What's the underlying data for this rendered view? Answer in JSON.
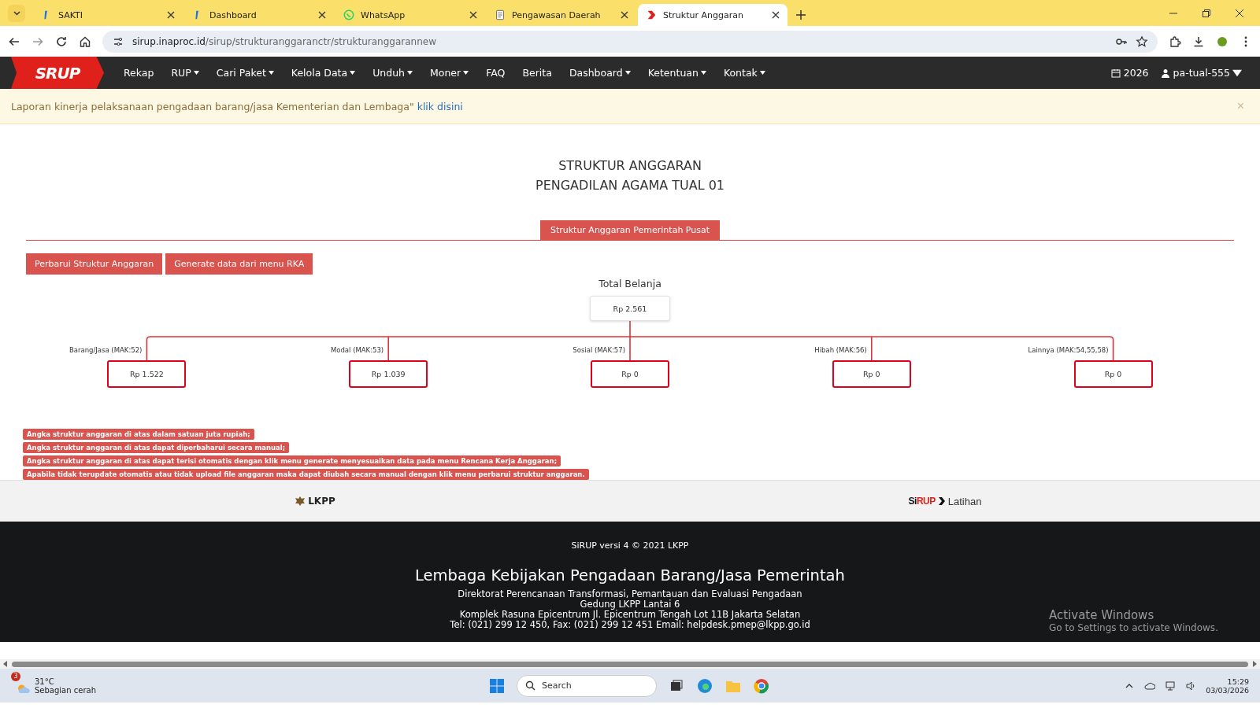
{
  "browser": {
    "tabs": [
      {
        "title": "SAKTI",
        "selected": false
      },
      {
        "title": "Dashboard",
        "selected": false
      },
      {
        "title": "WhatsApp",
        "selected": false
      },
      {
        "title": "Pengawasan Daerah",
        "selected": false
      },
      {
        "title": "Struktur Anggaran",
        "selected": true
      }
    ],
    "url_host": "sirup.inaproc.id",
    "url_path": "/sirup/strukturanggaranctr/strukturanggarannew"
  },
  "navbar": {
    "logo_prefix": "S",
    "logo_main": "RUP",
    "items": [
      {
        "label": "Rekap",
        "dropdown": false
      },
      {
        "label": "RUP",
        "dropdown": true
      },
      {
        "label": "Cari Paket",
        "dropdown": true
      },
      {
        "label": "Kelola Data",
        "dropdown": true
      },
      {
        "label": "Unduh",
        "dropdown": true
      },
      {
        "label": "Moner",
        "dropdown": true
      },
      {
        "label": "FAQ",
        "dropdown": false
      },
      {
        "label": "Berita",
        "dropdown": false
      },
      {
        "label": "Dashboard",
        "dropdown": true
      },
      {
        "label": "Ketentuan",
        "dropdown": true
      },
      {
        "label": "Kontak",
        "dropdown": true
      }
    ],
    "year": "2026",
    "user": "pa-tual-555"
  },
  "alert": {
    "text": "Laporan kinerja pelaksanaan pengadaan barang/jasa Kementerian dan Lembaga\"",
    "link": "klik disini",
    "close": "×"
  },
  "page": {
    "title_lines": [
      "STRUKTUR ANGGARAN",
      "PENGADILAN AGAMA TUAL 01"
    ],
    "section_tab": "Struktur Anggaran Pemerintah Pusat",
    "buttons": [
      "Perbarui Struktur Anggaran",
      "Generate data dari menu RKA"
    ],
    "total": {
      "label": "Total Belanja",
      "value": "Rp 2.561"
    },
    "branches": [
      {
        "label": "Barang/Jasa (MAK:52)",
        "value": "Rp 1.522"
      },
      {
        "label": "Modal (MAK:53)",
        "value": "Rp 1.039"
      },
      {
        "label": "Sosial (MAK:57)",
        "value": "Rp 0"
      },
      {
        "label": "Hibah (MAK:56)",
        "value": "Rp 0"
      },
      {
        "label": "Lainnya (MAK:54,55,58)",
        "value": "Rp 0"
      }
    ],
    "notes": [
      "Angka struktur anggaran di atas dalam satuan juta rupiah;",
      "Angka struktur anggaran di atas dapat diperbaharui secara manual;",
      "Angka struktur anggaran di atas dapat terisi otomatis dengan klik menu generate menyesuaikan data pada menu Rencana Kerja Anggaran;",
      "Apabila tidak terupdate otomatis atau tidak upload file anggaran maka dapat diubah secara manual dengan klik menu perbarui struktur anggaran."
    ]
  },
  "footer": {
    "lkpp": "LKPP",
    "sirup_prefix": "Si",
    "sirup_main": "RUP",
    "sirup_suffix": "Latihan",
    "version": "SiRUP versi 4 © 2021 LKPP",
    "org": "Lembaga Kebijakan Pengadaan Barang/Jasa Pemerintah",
    "address_lines": [
      "Direktorat Perencanaan Transformasi, Pemantauan dan Evaluasi Pengadaan",
      "Gedung LKPP Lantai 6",
      "Komplek Rasuna Epicentrum Jl. Epicentrum Tengah Lot 11B Jakarta Selatan",
      "Tel: (021) 299 12 450, Fax: (021) 299 12 451 Email: helpdesk.pmep@lkpp.go.id"
    ]
  },
  "activation": {
    "title": "Activate Windows",
    "hint": "Go to Settings to activate Windows."
  },
  "taskbar": {
    "weather_badge": "3",
    "temperature": "31°C",
    "weather": "Sebagian cerah",
    "search": "Search",
    "time": "15:29",
    "date": "03/03/2026"
  }
}
